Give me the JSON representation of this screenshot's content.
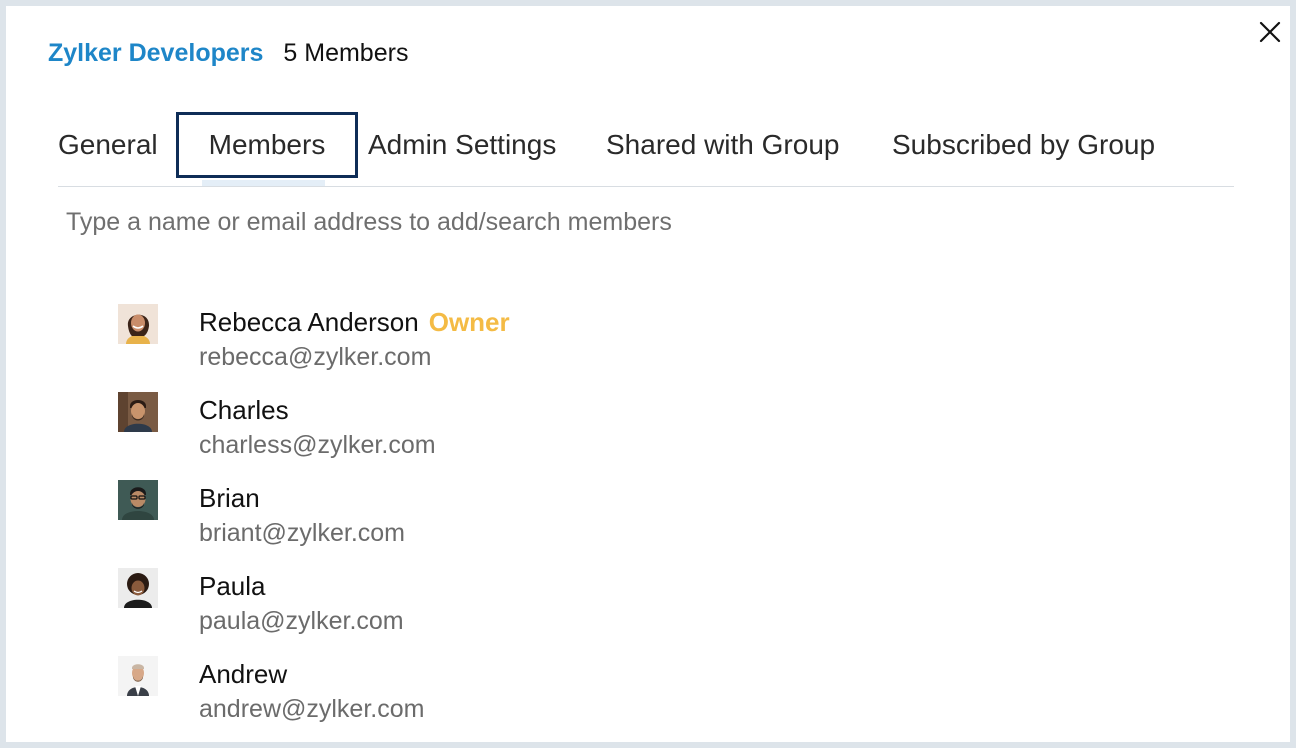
{
  "header": {
    "group_name": "Zylker Developers",
    "member_count": "5 Members"
  },
  "tabs": [
    {
      "label": "General",
      "active": false
    },
    {
      "label": "Members",
      "active": true
    },
    {
      "label": "Admin Settings",
      "active": false
    },
    {
      "label": "Shared with Group",
      "active": false
    },
    {
      "label": "Subscribed by Group",
      "active": false
    }
  ],
  "search": {
    "placeholder": "Type a name or email address to add/search members",
    "value": ""
  },
  "members": [
    {
      "name": "Rebecca Anderson",
      "badge": "Owner",
      "email": "rebecca@zylker.com"
    },
    {
      "name": "Charles",
      "email": "charless@zylker.com"
    },
    {
      "name": "Brian",
      "email": "briant@zylker.com"
    },
    {
      "name": "Paula",
      "email": "paula@zylker.com"
    },
    {
      "name": "Andrew",
      "email": "andrew@zylker.com"
    }
  ],
  "colors": {
    "group_name": "#1e86c8",
    "owner_badge": "#f4bb45",
    "active_tab_border": "#0e2d57"
  },
  "icons": {
    "close": "close-icon"
  }
}
